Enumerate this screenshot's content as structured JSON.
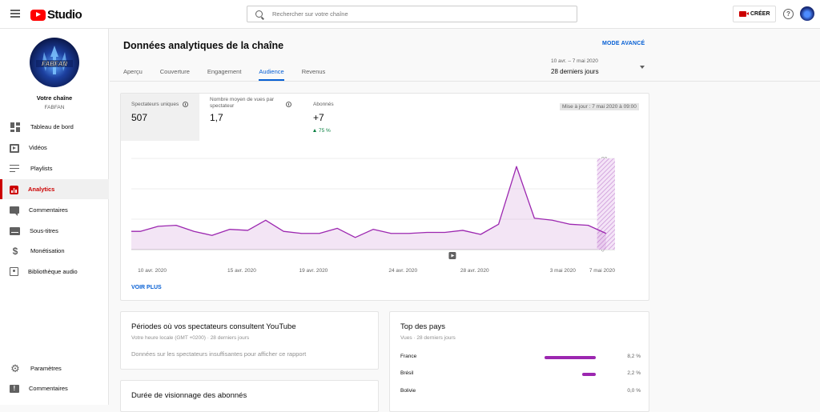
{
  "header": {
    "logo_text": "Studio",
    "search_placeholder": "Rechercher sur votre chaîne",
    "create_label": "CRÉER",
    "help_glyph": "?"
  },
  "sidebar": {
    "avatar_text": "FABFAN",
    "channel_title": "Votre chaîne",
    "channel_name": "FABFAN",
    "items": [
      {
        "label": "Tableau de bord",
        "icon": "dashboard-icon"
      },
      {
        "label": "Vidéos",
        "icon": "video-icon"
      },
      {
        "label": "Playlists",
        "icon": "playlist-icon"
      },
      {
        "label": "Analytics",
        "icon": "analytics-icon",
        "active": true
      },
      {
        "label": "Commentaires",
        "icon": "comment-icon"
      },
      {
        "label": "Sous-titres",
        "icon": "subtitles-icon"
      },
      {
        "label": "Monétisation",
        "icon": "dollar-icon"
      },
      {
        "label": "Bibliothèque audio",
        "icon": "audio-library-icon"
      }
    ],
    "bottom_items": [
      {
        "label": "Paramètres",
        "icon": "gear-icon"
      },
      {
        "label": "Commentaires",
        "icon": "feedback-icon"
      }
    ]
  },
  "page": {
    "title": "Données analytiques de la chaîne",
    "advanced_mode": "MODE AVANCÉ",
    "tabs": [
      {
        "label": "Aperçu"
      },
      {
        "label": "Couverture"
      },
      {
        "label": "Engagement"
      },
      {
        "label": "Audience",
        "active": true
      },
      {
        "label": "Revenus"
      }
    ],
    "date_range_small": "10 avr. – 7 mai 2020",
    "date_range_main": "28 derniers jours"
  },
  "metrics": {
    "unique_viewers_label": "Spectateurs uniques",
    "unique_viewers_value": "507",
    "avg_views_label_1": "Nombre moyen de vues par",
    "avg_views_label_2": "spectateur",
    "avg_views_value": "1,7",
    "subscribers_label": "Abonnés",
    "subscribers_value": "+7",
    "subscribers_delta": "75 %",
    "updated": "Mise à jour : 7 mai 2020 à 09:00",
    "see_more": "VOIR PLUS"
  },
  "chart_data": {
    "type": "area",
    "title": "",
    "xlabel": "",
    "ylabel": "",
    "x_tick_labels": [
      "10 avr. 2020",
      "15 avr. 2020",
      "19 avr. 2020",
      "24 avr. 2020",
      "28 avr. 2020",
      "3 mai 2020",
      "7 mai 2020"
    ],
    "x_tick_days": [
      0,
      5,
      9,
      14,
      18,
      23,
      27
    ],
    "y_ticks": [
      0,
      30,
      60,
      90
    ],
    "ylim": [
      0,
      90
    ],
    "series": [
      {
        "values": [
          18,
          23,
          24,
          18,
          14,
          20,
          19,
          29,
          18,
          16,
          16,
          21,
          12,
          20,
          16,
          16,
          17,
          17,
          19,
          15,
          25,
          82,
          31,
          29,
          25,
          24,
          16
        ]
      }
    ],
    "partial_last_day": true,
    "grid": true,
    "color": "#9c27b0"
  },
  "peak_card": {
    "title": "Périodes où vos spectateurs consultent YouTube",
    "subtitle": "Votre heure locale (GMT +0200) · 28 derniers jours",
    "note": "Données sur les spectateurs insuffisantes pour afficher ce rapport"
  },
  "watch_card": {
    "title": "Durée de visionnage des abonnés"
  },
  "countries_card": {
    "title": "Top des pays",
    "subtitle": "Vues · 28 derniers jours",
    "rows": [
      {
        "name": "France",
        "value": 8.2,
        "pct": "8,2 %"
      },
      {
        "name": "Brésil",
        "value": 2.2,
        "pct": "2,2 %"
      },
      {
        "name": "Bolivie",
        "value": 0.0,
        "pct": "0,0 %"
      }
    ]
  },
  "colors": {
    "accent_blue": "#065fd4",
    "brand_red": "#cc0000",
    "series_purple": "#9c27b0",
    "positive_green": "#0b8043"
  }
}
